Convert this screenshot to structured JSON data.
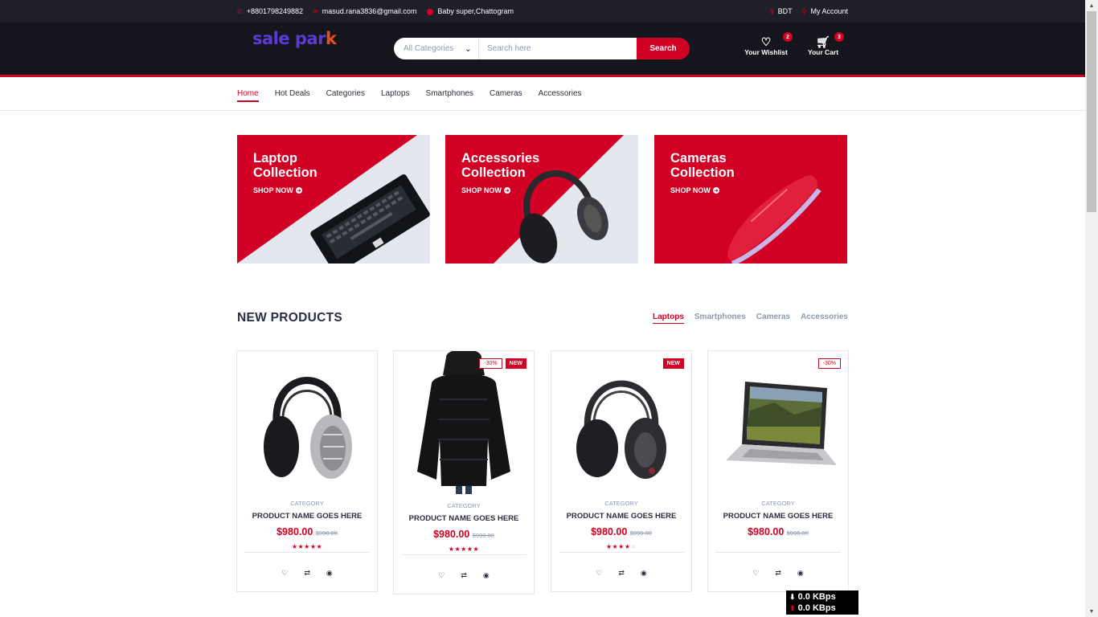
{
  "topbar": {
    "phone": "+8801798249882",
    "email": "masud.rana3836@gmail.com",
    "address": "Baby super,Chattogram",
    "currency": "BDT",
    "account": "My Account"
  },
  "header": {
    "logo_main": "sale par",
    "logo_accent": "k",
    "category_select": "All Categories",
    "search_placeholder": "Search here",
    "search_button": "Search",
    "wishlist_label": "Your Wishlist",
    "wishlist_count": "2",
    "cart_label": "Your Cart",
    "cart_count": "3"
  },
  "nav": {
    "items": [
      "Home",
      "Hot Deals",
      "Categories",
      "Laptops",
      "Smartphones",
      "Cameras",
      "Accessories"
    ],
    "active": "Home"
  },
  "collections": [
    {
      "title_line1": "Laptop",
      "title_line2": "Collection",
      "cta": "SHOP NOW"
    },
    {
      "title_line1": "Accessories",
      "title_line2": "Collection",
      "cta": "SHOP NOW"
    },
    {
      "title_line1": "Cameras",
      "title_line2": "Collection",
      "cta": "SHOP NOW"
    }
  ],
  "new_products": {
    "title": "NEW PRODUCTS",
    "tabs": [
      "Laptops",
      "Smartphones",
      "Cameras",
      "Accessories"
    ],
    "active_tab": "Laptops",
    "items": [
      {
        "category": "CATEGORY",
        "name": "PRODUCT NAME GOES HERE",
        "price": "$980.00",
        "old_price": "$990.00",
        "rating": 5,
        "sale": "",
        "new": "",
        "image": "headphones-silver-image"
      },
      {
        "category": "CATEGORY",
        "name": "PRODUCT NAME GOES HERE",
        "price": "$980.00",
        "old_price": "$990.00",
        "rating": 5,
        "sale": "-30%",
        "new": "NEW",
        "image": "black-jacket-image"
      },
      {
        "category": "CATEGORY",
        "name": "PRODUCT NAME GOES HERE",
        "price": "$980.00",
        "old_price": "$990.00",
        "rating": 4,
        "sale": "",
        "new": "NEW",
        "image": "headphones-black-image"
      },
      {
        "category": "CATEGORY",
        "name": "PRODUCT NAME GOES HERE",
        "price": "$980.00",
        "old_price": "$990.00",
        "rating": 0,
        "sale": "-30%",
        "new": "",
        "image": "laptop-image"
      }
    ]
  },
  "speed_widget": {
    "down": "0.0 KBps",
    "up": "0.0 KBps"
  },
  "colors": {
    "primary": "#d10024",
    "header_bg": "#15161d",
    "topbar_bg": "#1e1f29",
    "text": "#2b2d42",
    "muted": "#8d99ae"
  }
}
